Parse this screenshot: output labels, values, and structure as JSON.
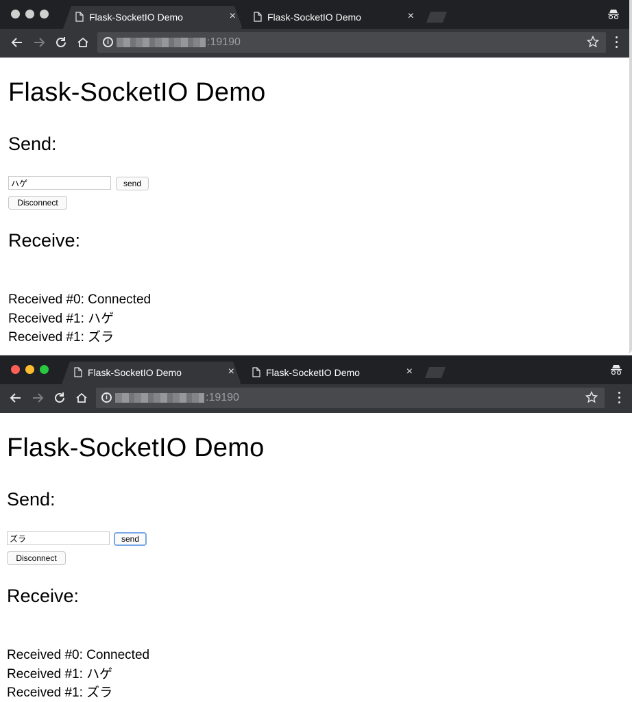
{
  "windows": [
    {
      "tabs": [
        {
          "title": "Flask-SocketIO Demo",
          "close": "×"
        },
        {
          "title": "Flask-SocketIO Demo",
          "close": "×"
        }
      ],
      "url": ":19190",
      "traffic_light_colors": [
        "#cfcfcf",
        "#cfcfcf",
        "#cfcfcf"
      ],
      "page": {
        "title": "Flask-SocketIO Demo",
        "send_heading": "Send:",
        "input_value": "ハゲ",
        "send_button": "send",
        "disconnect_button": "Disconnect",
        "receive_heading": "Receive:",
        "log": [
          "Received #0: Connected",
          "Received #1: ハゲ",
          "Received #1: ズラ"
        ]
      }
    },
    {
      "tabs": [
        {
          "title": "Flask-SocketIO Demo",
          "close": "×"
        },
        {
          "title": "Flask-SocketIO Demo",
          "close": "×"
        }
      ],
      "url": ":19190",
      "traffic_light_colors": [
        "#fe5f57",
        "#febc2e",
        "#28c840"
      ],
      "page": {
        "title": "Flask-SocketIO Demo",
        "send_heading": "Send:",
        "input_value": "ズラ",
        "send_button": "send",
        "disconnect_button": "Disconnect",
        "receive_heading": "Receive:",
        "log": [
          "Received #0: Connected",
          "Received #1: ハゲ",
          "Received #1: ズラ"
        ]
      }
    }
  ],
  "colors": {
    "tabstrip": "#202124",
    "toolbar": "#35363a",
    "omnibox": "#48494d",
    "focus_ring": "#7aa7e6"
  }
}
